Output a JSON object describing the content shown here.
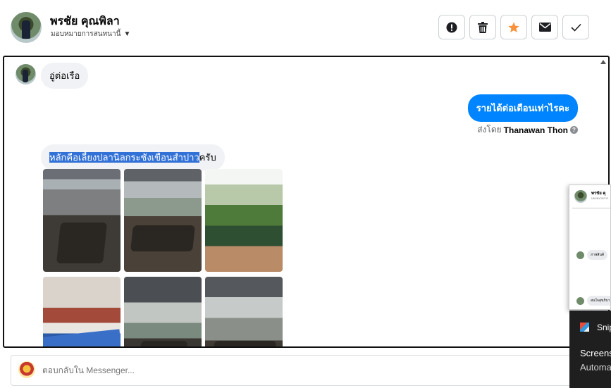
{
  "header": {
    "contact_name": "พรชัย คุณพิลา",
    "assign_label": "มอบหมายการสนทนานี้",
    "actions": [
      {
        "name": "mark-spam-button",
        "icon": "alert-circle-icon"
      },
      {
        "name": "delete-button",
        "icon": "trash-icon"
      },
      {
        "name": "star-button",
        "icon": "star-icon",
        "color": "#f7923a"
      },
      {
        "name": "mark-unread-button",
        "icon": "envelope-icon"
      },
      {
        "name": "mark-done-button",
        "icon": "check-icon"
      }
    ]
  },
  "thread": {
    "messages": [
      {
        "direction": "in",
        "text": "อู่ต่อเรือ"
      },
      {
        "direction": "out",
        "text": "รายได้ต่อเดือนเท่าไรคะ"
      },
      {
        "direction": "in",
        "text_highlighted": "หลักคือเลี้ยงปลานิลกระชังเขื่อนสำปาว",
        "text_rest": "ครับ"
      }
    ],
    "sent_by_prefix": "ส่งโดย",
    "sent_by_name": "Thanawan Thon",
    "help_glyph": "?",
    "accent_color": "#0084ff"
  },
  "reply": {
    "placeholder": "ตอบกลับใน Messenger..."
  },
  "mini_window": {
    "name": "พรชัย คุ",
    "sub": "มอบหมายการ",
    "rows": [
      "ภาพสินค้",
      "สนใจสุขภิบาล"
    ]
  },
  "snip_toast": {
    "title": "Snip",
    "line1": "Screens",
    "line2": "Automa"
  }
}
